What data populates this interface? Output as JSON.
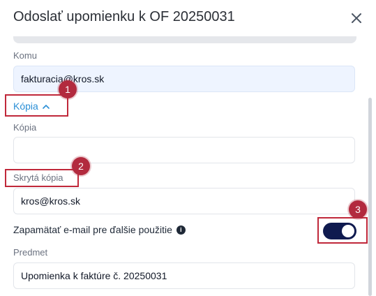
{
  "dialog": {
    "title": "Odoslať upomienku k OF 20250031",
    "close_icon": "close-icon"
  },
  "form": {
    "to_label": "Komu",
    "to_value": "fakturacia@kros.sk",
    "cc_toggle_label": "Kópia",
    "cc_toggle_icon": "chevron-up-icon",
    "cc_label": "Kópia",
    "cc_value": "",
    "bcc_label": "Skrytá kópia",
    "bcc_value": "kros@kros.sk",
    "remember_label": "Zapamätať e-mail pre ďalšie použitie",
    "remember_info_icon": "info-icon",
    "remember_on": true,
    "subject_label": "Predmet",
    "subject_value": "Upomienka k faktúre č. 20250031"
  },
  "annotations": {
    "badge1": "1",
    "badge2": "2",
    "badge3": "3"
  },
  "colors": {
    "accent": "#2a8fd6",
    "toggle_on": "#0f1a4f",
    "highlight": "#c0283a",
    "badge": "#b22a3e"
  }
}
